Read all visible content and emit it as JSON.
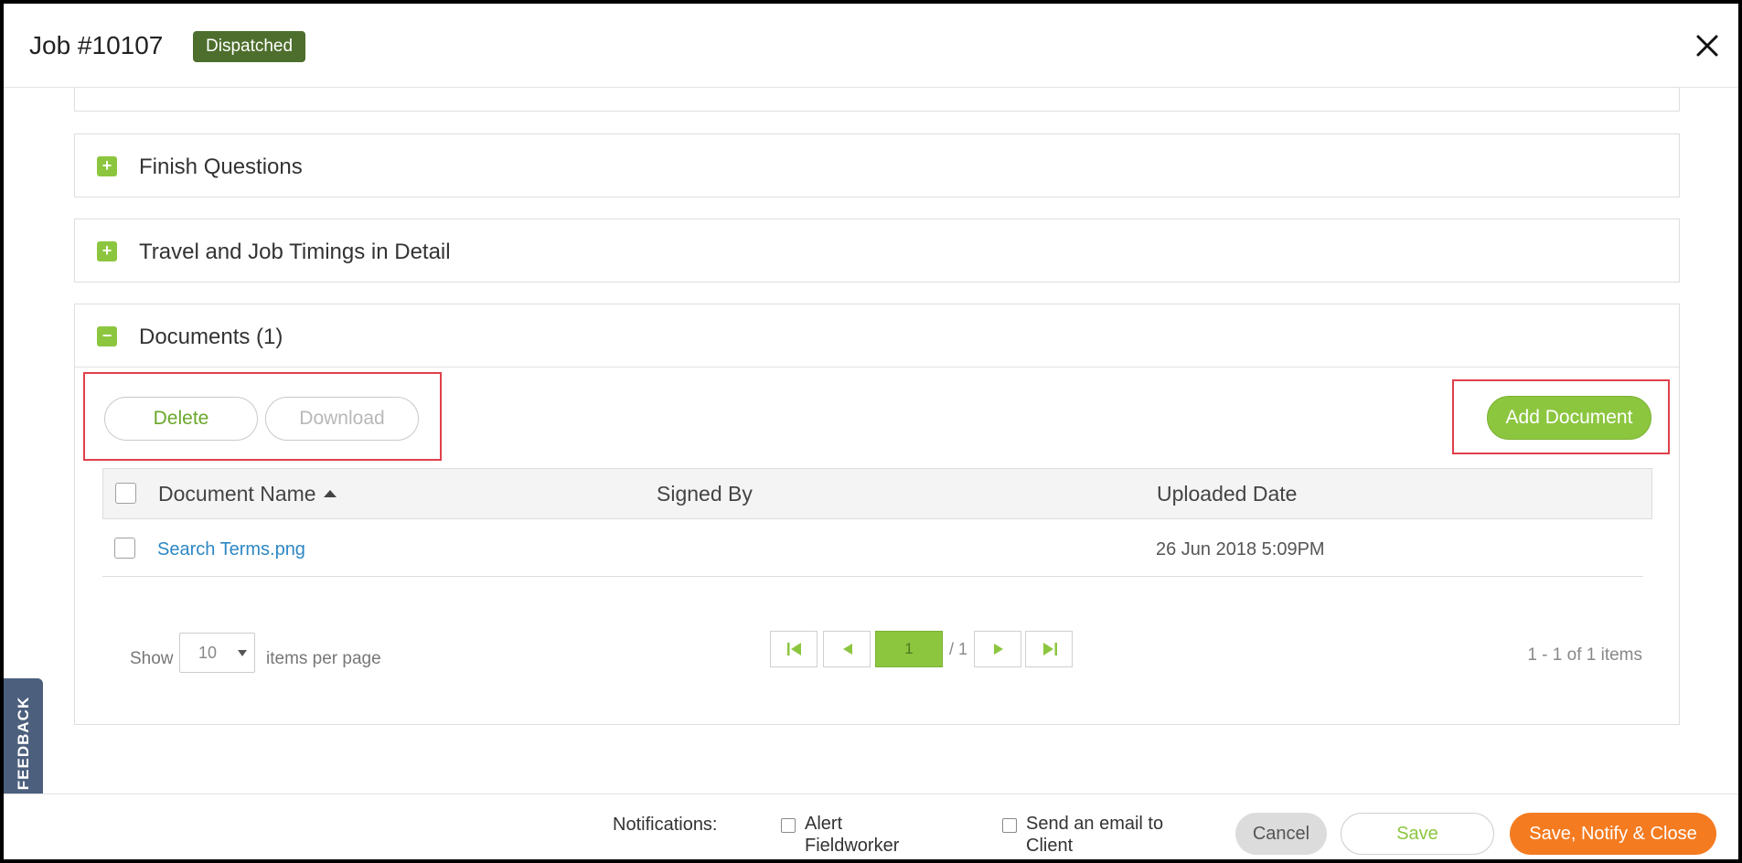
{
  "header": {
    "job_title": "Job #10107",
    "status": "Dispatched"
  },
  "panels": {
    "finish_questions": "Finish Questions",
    "travel_timings": "Travel and Job Timings in Detail",
    "documents": "Documents (1)"
  },
  "documents": {
    "delete_label": "Delete",
    "download_label": "Download",
    "add_label": "Add Document",
    "columns": [
      "Document Name",
      "Signed By",
      "Uploaded Date"
    ],
    "rows": [
      {
        "name": "Search Terms.png",
        "signed_by": "",
        "uploaded": "26 Jun 2018 5:09PM"
      }
    ],
    "pager": {
      "show": "Show",
      "page_size": "10",
      "items_per_page": "items per page",
      "current_page": "1",
      "total_pages": "/ 1",
      "info": "1 - 1 of 1 items"
    }
  },
  "feedback": "FEEDBACK",
  "footer": {
    "notifications_label": "Notifications:",
    "alert_fieldworker": "Alert Fieldworker",
    "email_client": "Send an email to Client",
    "cancel": "Cancel",
    "save": "Save",
    "save_notify_close": "Save, Notify & Close"
  },
  "colors": {
    "accent_green": "#8cc63f",
    "badge_green": "#4d6e2c",
    "orange": "#f47b20",
    "highlight_red": "#e0404a",
    "link_blue": "#2d87c4"
  }
}
